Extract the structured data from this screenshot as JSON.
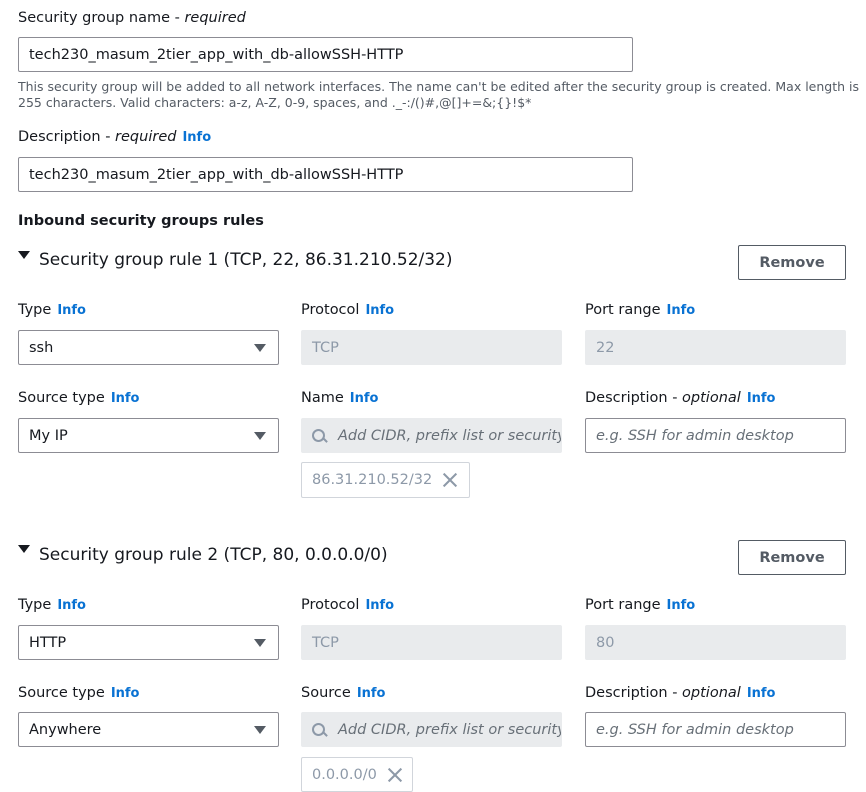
{
  "name_field": {
    "label": "Security group name - ",
    "label_req": "required",
    "value": "tech230_masum_2tier_app_with_db-allowSSH-HTTP",
    "hint_line1": "This security group will be added to all network interfaces. The name can't be edited after the security group is created. Max length is",
    "hint_line2": "255 characters. Valid characters: a-z, A-Z, 0-9, spaces, and ._-:/()#,@[]+=&;{}!$*"
  },
  "description_field": {
    "label": "Description - ",
    "label_req": "required",
    "info": "Info",
    "value": "tech230_masum_2tier_app_with_db-allowSSH-HTTP"
  },
  "inbound": {
    "title": "Inbound security groups rules",
    "rules": [
      {
        "title": "Security group rule 1 (TCP, 22, 86.31.210.52/32)",
        "remove": "Remove",
        "type_label": "Type",
        "type_value": "ssh",
        "protocol_label": "Protocol",
        "protocol_value": "TCP",
        "port_label": "Port range",
        "port_value": "22",
        "source_type_label": "Source type",
        "source_type_value": "My IP",
        "source_label": "Name",
        "source_placeholder": "Add CIDR, prefix list or security",
        "desc_label": "Description - ",
        "desc_opt": "optional",
        "desc_placeholder": "e.g. SSH for admin desktop",
        "token": "86.31.210.52/32"
      },
      {
        "title": "Security group rule 2 (TCP, 80, 0.0.0.0/0)",
        "remove": "Remove",
        "type_label": "Type",
        "type_value": "HTTP",
        "protocol_label": "Protocol",
        "protocol_value": "TCP",
        "port_label": "Port range",
        "port_value": "80",
        "source_type_label": "Source type",
        "source_type_value": "Anywhere",
        "source_label": "Source",
        "source_placeholder": "Add CIDR, prefix list or security",
        "desc_label": "Description - ",
        "desc_opt": "optional",
        "desc_placeholder": "e.g. SSH for admin desktop",
        "token": "0.0.0.0/0"
      }
    ]
  },
  "info_label": "Info",
  "colors": {
    "link": "#0972d3",
    "disabled_bg": "#e9ebed",
    "border": "#8c8c94"
  }
}
